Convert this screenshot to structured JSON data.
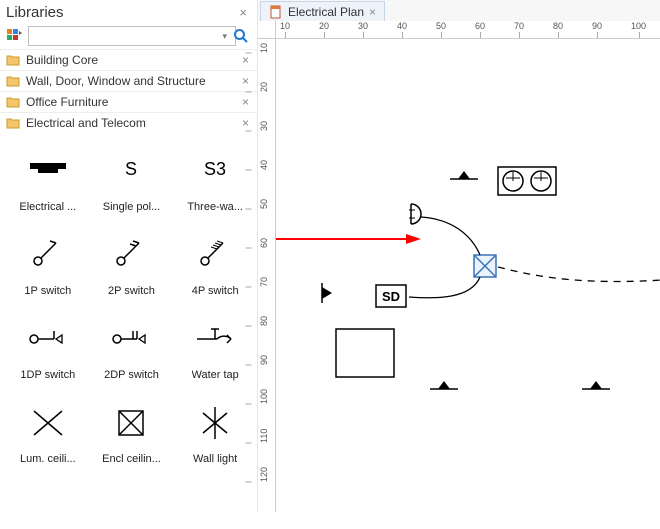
{
  "panel": {
    "title": "Libraries"
  },
  "search": {
    "placeholder": ""
  },
  "categories": [
    {
      "label": "Building Core"
    },
    {
      "label": "Wall, Door, Window and Structure"
    },
    {
      "label": "Office Furniture"
    },
    {
      "label": "Electrical and Telecom"
    }
  ],
  "shapes": [
    {
      "label": "Electrical ...",
      "icon": "electrical"
    },
    {
      "label": "Single pol...",
      "icon": "text-s"
    },
    {
      "label": "Three-wa...",
      "icon": "text-s3"
    },
    {
      "label": "1P switch",
      "icon": "sw1"
    },
    {
      "label": "2P switch",
      "icon": "sw2"
    },
    {
      "label": "4P switch",
      "icon": "sw4"
    },
    {
      "label": "1DP switch",
      "icon": "dp1"
    },
    {
      "label": "2DP switch",
      "icon": "dp2"
    },
    {
      "label": "Water tap",
      "icon": "tap"
    },
    {
      "label": "Lum. ceili...",
      "icon": "xplain"
    },
    {
      "label": "Encl ceilin...",
      "icon": "xbox"
    },
    {
      "label": "Wall light",
      "icon": "xline"
    }
  ],
  "tab": {
    "title": "Electrical Plan"
  },
  "ruler_h": [
    "10",
    "20",
    "30",
    "40",
    "50",
    "60",
    "70",
    "80",
    "90",
    "100"
  ],
  "ruler_v": [
    "10",
    "20",
    "30",
    "40",
    "50",
    "60",
    "70",
    "80",
    "90",
    "100",
    "110",
    "120"
  ],
  "canvas": {
    "sd_label": "SD"
  }
}
